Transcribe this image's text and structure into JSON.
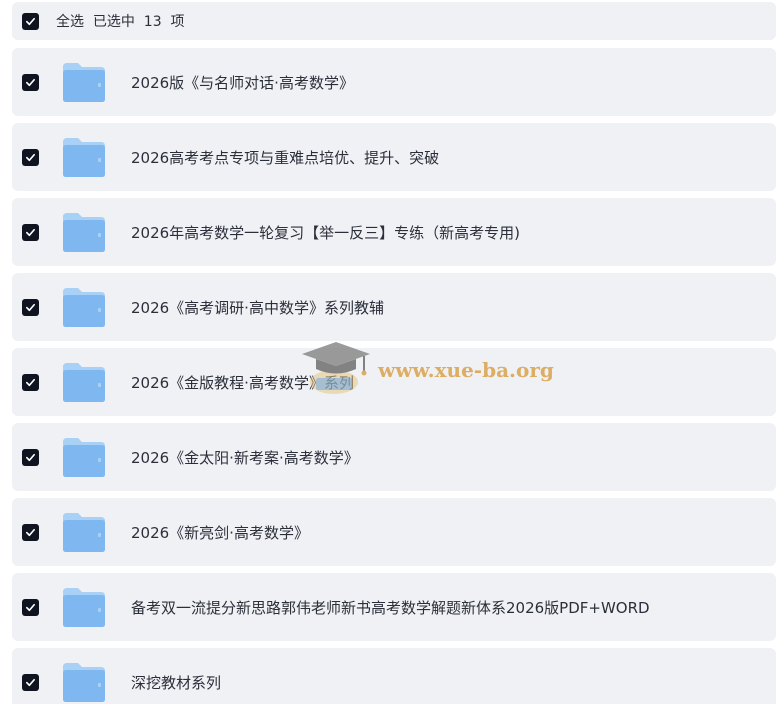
{
  "header": {
    "select_all_text": "全选  已选中  13  项",
    "checked": true
  },
  "items": [
    {
      "label": "2026版《与名师对话·高考数学》",
      "checked": true
    },
    {
      "label": "2026高考考点专项与重难点培优、提升、突破",
      "checked": true
    },
    {
      "label": "2026年高考数学一轮复习【举一反三】专练（新高考专用)",
      "checked": true
    },
    {
      "label": "2026《高考调研·高中数学》系列教辅",
      "checked": true
    },
    {
      "label": "2026《金版教程·高考数学》系列",
      "checked": true
    },
    {
      "label": "2026《金太阳·新考案·高考数学》",
      "checked": true
    },
    {
      "label": "2026《新亮剑·高考数学》",
      "checked": true
    },
    {
      "label": "备考双一流提分新思路郭伟老师新书高考数学解题新体系2026版PDF+WORD",
      "checked": true
    },
    {
      "label": "深挖教材系列",
      "checked": true
    }
  ],
  "watermark": {
    "text": "www.xue-ba.org"
  },
  "colors": {
    "row_background": "#f0f1f5",
    "checkbox": "#0f1420",
    "folder": "#7fb8f0",
    "watermark": "#d9a24a"
  },
  "icons": {
    "checkbox": "checkbox-checked-icon",
    "folder": "folder-icon",
    "watermark_logo": "graduation-cap-logo"
  }
}
